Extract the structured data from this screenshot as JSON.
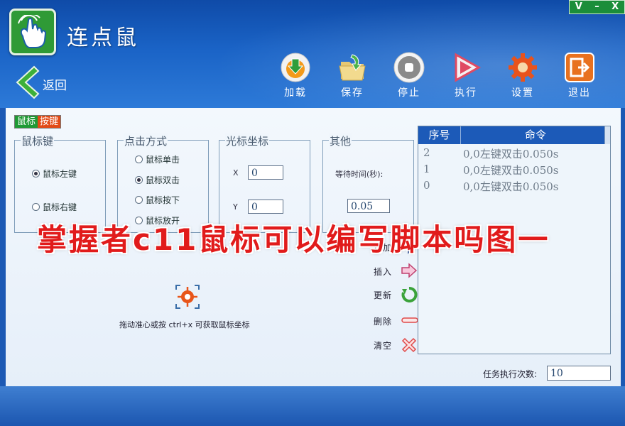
{
  "app": {
    "title": "连点鼠"
  },
  "window_controls": {
    "minimize_v": "V",
    "minimize": "–",
    "close": "X"
  },
  "nav": {
    "back_label": "返回"
  },
  "toolbar": [
    {
      "label": "加载",
      "icon": "load-download-icon"
    },
    {
      "label": "保存",
      "icon": "save-folder-icon"
    },
    {
      "label": "停止",
      "icon": "stop-icon"
    },
    {
      "label": "执行",
      "icon": "play-icon"
    },
    {
      "label": "设置",
      "icon": "gear-icon"
    },
    {
      "label": "退出",
      "icon": "exit-icon"
    }
  ],
  "tab": {
    "mouse": "鼠标",
    "key": "按键"
  },
  "mouse_key_group": {
    "title": "鼠标键",
    "options": [
      "鼠标左键",
      "鼠标右键"
    ],
    "selected": "鼠标左键"
  },
  "click_mode_group": {
    "title": "点击方式",
    "options": [
      "鼠标单击",
      "鼠标双击",
      "鼠标按下",
      "鼠标放开"
    ],
    "selected": "鼠标双击"
  },
  "cursor_group": {
    "title": "光标坐标",
    "x_label": "X",
    "x_value": "0",
    "y_label": "Y",
    "y_value": "0"
  },
  "other_group": {
    "title": "其他",
    "wait_label": "等待时间(秒):",
    "wait_value": "0.05"
  },
  "target_hint": "拖动准心或按 ctrl+x 可获取鼠标坐标",
  "ops": {
    "add": "追加",
    "insert": "插入",
    "update": "更新",
    "delete": "删除",
    "clear": "清空"
  },
  "command_list": {
    "col_index": "序号",
    "col_command": "命令",
    "rows": [
      {
        "index": "2",
        "command": "0,0左键双击0.050s"
      },
      {
        "index": "1",
        "command": "0,0左键双击0.050s"
      },
      {
        "index": "0",
        "command": "0,0左键双击0.050s"
      }
    ]
  },
  "task": {
    "label": "任务执行次数:",
    "value": "10"
  },
  "watermark": "掌握者c11鼠标可以编写脚本吗图一",
  "colors": {
    "header_blue": "#1a63c6",
    "accent_green": "#1f9a35",
    "accent_red": "#e24a16",
    "watermark_red": "#e11b1b"
  }
}
